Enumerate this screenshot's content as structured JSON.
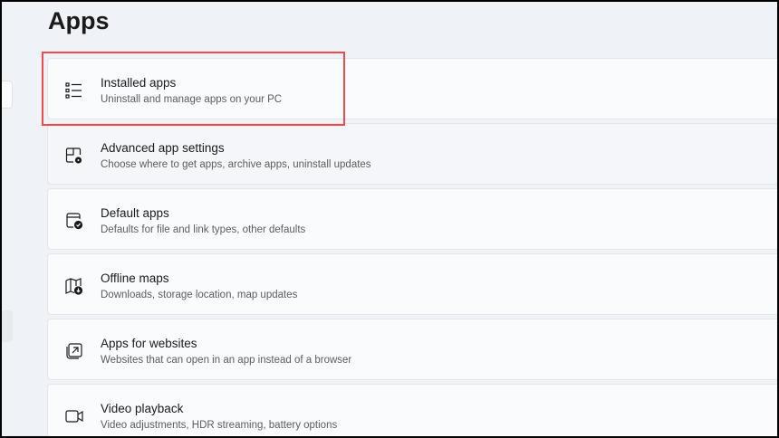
{
  "page_title": "Apps",
  "highlight_color": "#f04a4a",
  "items": [
    {
      "icon": "list-icon",
      "title": "Installed apps",
      "subtitle": "Uninstall and manage apps on your PC"
    },
    {
      "icon": "app-settings-icon",
      "title": "Advanced app settings",
      "subtitle": "Choose where to get apps, archive apps, uninstall updates"
    },
    {
      "icon": "default-apps-icon",
      "title": "Default apps",
      "subtitle": "Defaults for file and link types, other defaults"
    },
    {
      "icon": "offline-maps-icon",
      "title": "Offline maps",
      "subtitle": "Downloads, storage location, map updates"
    },
    {
      "icon": "apps-for-websites-icon",
      "title": "Apps for websites",
      "subtitle": "Websites that can open in an app instead of a browser"
    },
    {
      "icon": "video-icon",
      "title": "Video playback",
      "subtitle": "Video adjustments, HDR streaming, battery options"
    }
  ]
}
